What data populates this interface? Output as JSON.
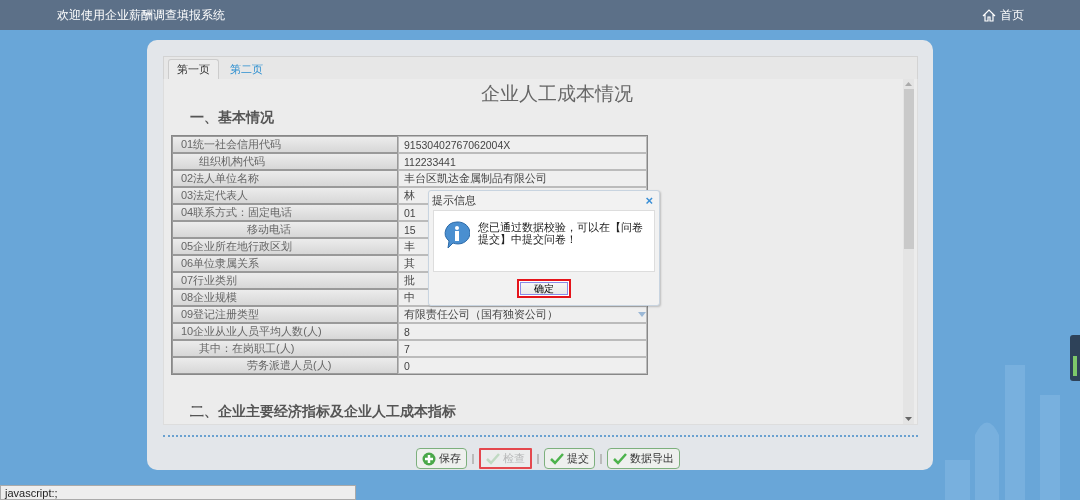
{
  "header": {
    "title": "欢迎使用企业薪酬调查填报系统",
    "home_link": "首页"
  },
  "tabs": [
    {
      "label": "第一页",
      "selected": true
    },
    {
      "label": "第二页",
      "selected": false
    }
  ],
  "form": {
    "title": "企业人工成本情况",
    "section_1": "一、基本情况",
    "rows": [
      {
        "label": "01统一社会信用代码",
        "value": "91530402767062004X",
        "kind": "main"
      },
      {
        "label": "组织机构代码",
        "value": "112233441",
        "kind": "sub"
      },
      {
        "label": "02法人单位名称",
        "value": "丰台区凯达金属制品有限公司",
        "kind": "main"
      },
      {
        "label": "03法定代表人",
        "value": "林",
        "kind": "main"
      },
      {
        "label": "04联系方式：固定电话",
        "value": "01",
        "kind": "main"
      },
      {
        "label": "移动电话",
        "value": "15",
        "kind": "deep"
      },
      {
        "label": "05企业所在地行政区划",
        "value": "丰",
        "kind": "main"
      },
      {
        "label": "06单位隶属关系",
        "value": "其",
        "kind": "main"
      },
      {
        "label": "07行业类别",
        "value": "批",
        "kind": "main"
      },
      {
        "label": "08企业规模",
        "value": "中",
        "kind": "main"
      },
      {
        "label": "09登记注册类型",
        "value": "有限责任公司（国有独资公司）",
        "kind": "select"
      },
      {
        "label": "10企业从业人员平均人数(人)",
        "value": "8",
        "kind": "main"
      },
      {
        "label": "其中：在岗职工(人)",
        "value": "7",
        "kind": "sub"
      },
      {
        "label": "劳务派遣人员(人)",
        "value": "0",
        "kind": "deep"
      }
    ],
    "section_2": "二、企业主要经济指标及企业人工成本指标"
  },
  "actions": [
    {
      "label": "保存",
      "kind": "add",
      "disabled": false,
      "highlighted": false
    },
    {
      "label": "检查",
      "kind": "check",
      "disabled": true,
      "highlighted": true
    },
    {
      "label": "提交",
      "kind": "check",
      "disabled": false,
      "highlighted": false
    },
    {
      "label": "数据导出",
      "kind": "check",
      "disabled": false,
      "highlighted": false
    }
  ],
  "dialog": {
    "title": "提示信息",
    "close": "×",
    "message": "您已通过数据校验，可以在【问卷提交】中提交问卷！",
    "ok_button": "确定",
    "ok_highlighted": true
  },
  "status_bar": "javascript:;"
}
